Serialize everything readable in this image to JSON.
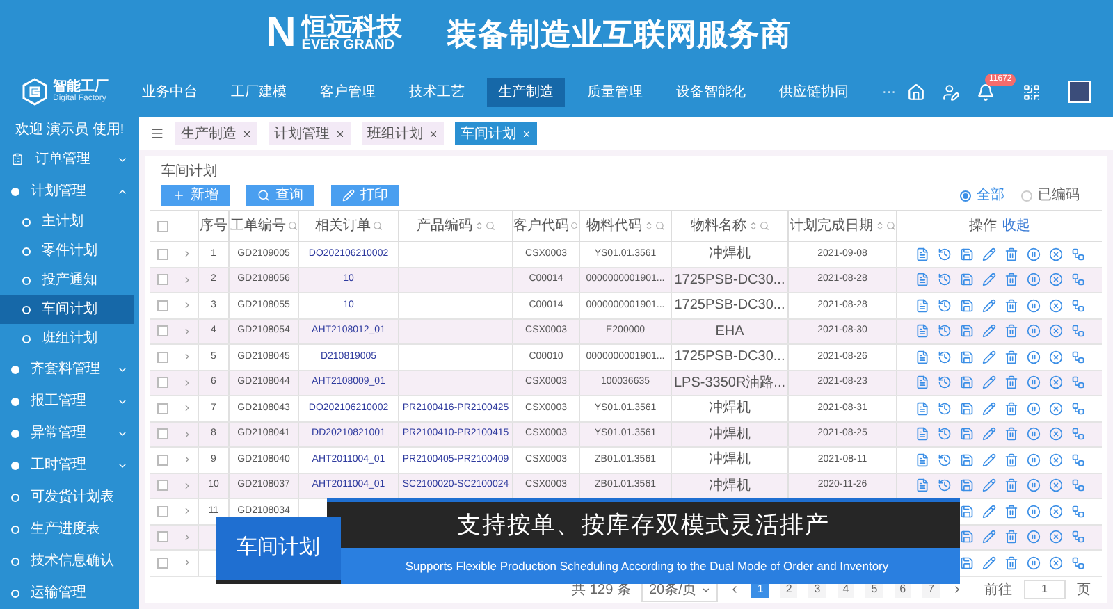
{
  "banner": {
    "logo_mark": "N",
    "logo_name": "恒远科技",
    "logo_sub": "EVER GRAND",
    "slogan": "装备制造业互联网服务商"
  },
  "app": {
    "name": "智能工厂",
    "sub": "Digital Factory"
  },
  "nav": [
    {
      "label": "业务中台",
      "selected": false
    },
    {
      "label": "工厂建模",
      "selected": false
    },
    {
      "label": "客户管理",
      "selected": false
    },
    {
      "label": "技术工艺",
      "selected": false
    },
    {
      "label": "生产制造",
      "selected": true
    },
    {
      "label": "质量管理",
      "selected": false
    },
    {
      "label": "设备智能化",
      "selected": false
    },
    {
      "label": "供应链协同",
      "selected": false
    },
    {
      "label": "···",
      "selected": false
    }
  ],
  "notification_badge": "11672",
  "welcome": "欢迎 演示员 使用!",
  "sidebar": [
    {
      "label": "订单管理",
      "kind": "group",
      "expanded": false
    },
    {
      "label": "计划管理",
      "kind": "group",
      "expanded": true,
      "children": [
        {
          "label": "主计划",
          "selected": false
        },
        {
          "label": "零件计划",
          "selected": false
        },
        {
          "label": "投产通知",
          "selected": false
        },
        {
          "label": "车间计划",
          "selected": true
        },
        {
          "label": "班组计划",
          "selected": false
        }
      ]
    },
    {
      "label": "齐套料管理",
      "kind": "group",
      "expanded": false
    },
    {
      "label": "报工管理",
      "kind": "group",
      "expanded": false
    },
    {
      "label": "异常管理",
      "kind": "group",
      "expanded": false
    },
    {
      "label": "工时管理",
      "kind": "group",
      "expanded": false
    },
    {
      "label": "可发货计划表",
      "kind": "link"
    },
    {
      "label": "生产进度表",
      "kind": "link"
    },
    {
      "label": "技术信息确认",
      "kind": "link"
    },
    {
      "label": "运输管理",
      "kind": "link"
    }
  ],
  "tabs": [
    {
      "label": "生产制造",
      "selected": false
    },
    {
      "label": "计划管理",
      "selected": false
    },
    {
      "label": "班组计划",
      "selected": false
    },
    {
      "label": "车间计划",
      "selected": true
    }
  ],
  "breadcrumb": "车间计划",
  "buttons": [
    {
      "kind": "add",
      "label": "新增"
    },
    {
      "kind": "search",
      "label": "查询"
    },
    {
      "kind": "print",
      "label": "打印"
    }
  ],
  "filters": [
    {
      "label": "全部",
      "selected": true
    },
    {
      "label": "已编码",
      "selected": false
    }
  ],
  "table": {
    "all_checked": false,
    "columns": [
      {
        "label": "序号",
        "kind": "text",
        "sortable": false,
        "searchable": false
      },
      {
        "label": "工单编号",
        "kind": "text",
        "sortable": false,
        "searchable": true
      },
      {
        "label": "相关订单",
        "kind": "link",
        "sortable": false,
        "searchable": true
      },
      {
        "label": "产品编码",
        "kind": "link",
        "sortable": true,
        "searchable": true
      },
      {
        "label": "客户代码",
        "kind": "text",
        "sortable": false,
        "searchable": true
      },
      {
        "label": "物料代码",
        "kind": "text",
        "sortable": true,
        "searchable": true
      },
      {
        "label": "物料名称",
        "kind": "text",
        "sortable": true,
        "searchable": true
      },
      {
        "label": "计划完成日期",
        "kind": "text",
        "sortable": true,
        "searchable": true
      }
    ],
    "actions_label": "操作",
    "collapse_label": "收起",
    "rows": [
      {
        "checked": false,
        "cells": [
          "1",
          "GD2109005",
          "DO202106210002",
          "",
          "CSX0003",
          "YS01.01.3561",
          "冲焊机",
          "2021-09-08"
        ]
      },
      {
        "checked": false,
        "cells": [
          "2",
          "GD2108056",
          "10",
          "",
          "C00014",
          "0000000001901...",
          "1725PSB-DC30...",
          "2021-08-28"
        ]
      },
      {
        "checked": false,
        "cells": [
          "3",
          "GD2108055",
          "10",
          "",
          "C00014",
          "0000000001901...",
          "1725PSB-DC30...",
          "2021-08-28"
        ]
      },
      {
        "checked": false,
        "cells": [
          "4",
          "GD2108054",
          "AHT2108012_01",
          "",
          "CSX0003",
          "E200000",
          "EHA",
          "2021-08-30"
        ]
      },
      {
        "checked": false,
        "cells": [
          "5",
          "GD2108045",
          "D210819005",
          "",
          "C00010",
          "0000000001901...",
          "1725PSB-DC30...",
          "2021-08-26"
        ]
      },
      {
        "checked": false,
        "cells": [
          "6",
          "GD2108044",
          "AHT2108009_01",
          "",
          "CSX0003",
          "100036635",
          "LPS-3350R油路...",
          "2021-08-23"
        ]
      },
      {
        "checked": false,
        "cells": [
          "7",
          "GD2108043",
          "DO202106210002",
          "PR2100416-PR2100425",
          "CSX0003",
          "YS01.01.3561",
          "冲焊机",
          "2021-08-31"
        ]
      },
      {
        "checked": false,
        "cells": [
          "8",
          "GD2108041",
          "DD20210821001",
          "PR2100410-PR2100415",
          "CSX0003",
          "YS01.01.3561",
          "冲焊机",
          "2021-08-25"
        ]
      },
      {
        "checked": false,
        "cells": [
          "9",
          "GD2108040",
          "AHT2011004_01",
          "PR2100405-PR2100409",
          "CSX0003",
          "ZB01.01.3561",
          "冲焊机",
          "2021-08-11"
        ]
      },
      {
        "checked": false,
        "cells": [
          "10",
          "GD2108037",
          "AHT2011004_01",
          "SC2100020-SC2100024",
          "CSX0003",
          "ZB01.01.3561",
          "冲焊机",
          "2020-11-26"
        ]
      },
      {
        "checked": false,
        "cells": [
          "11",
          "GD2108034"
        ]
      },
      {
        "checked": false
      },
      {
        "checked": false
      }
    ]
  },
  "pagination": {
    "total": "共 129 条",
    "page_size": "20条/页",
    "pages": [
      {
        "label": "1",
        "selected": true
      },
      {
        "label": "2",
        "selected": false
      },
      {
        "label": "3",
        "selected": false
      },
      {
        "label": "4",
        "selected": false
      },
      {
        "label": "5",
        "selected": false
      },
      {
        "label": "6",
        "selected": false
      },
      {
        "label": "7",
        "selected": false
      }
    ],
    "goto_label": "前往",
    "goto_value": "1",
    "page_unit": "页"
  },
  "caption": {
    "tag": "车间计划",
    "title": "支持按单、按库存双模式灵活排产",
    "subtitle": "Supports Flexible Production Scheduling According to the Dual Mode of Order and Inventory"
  }
}
